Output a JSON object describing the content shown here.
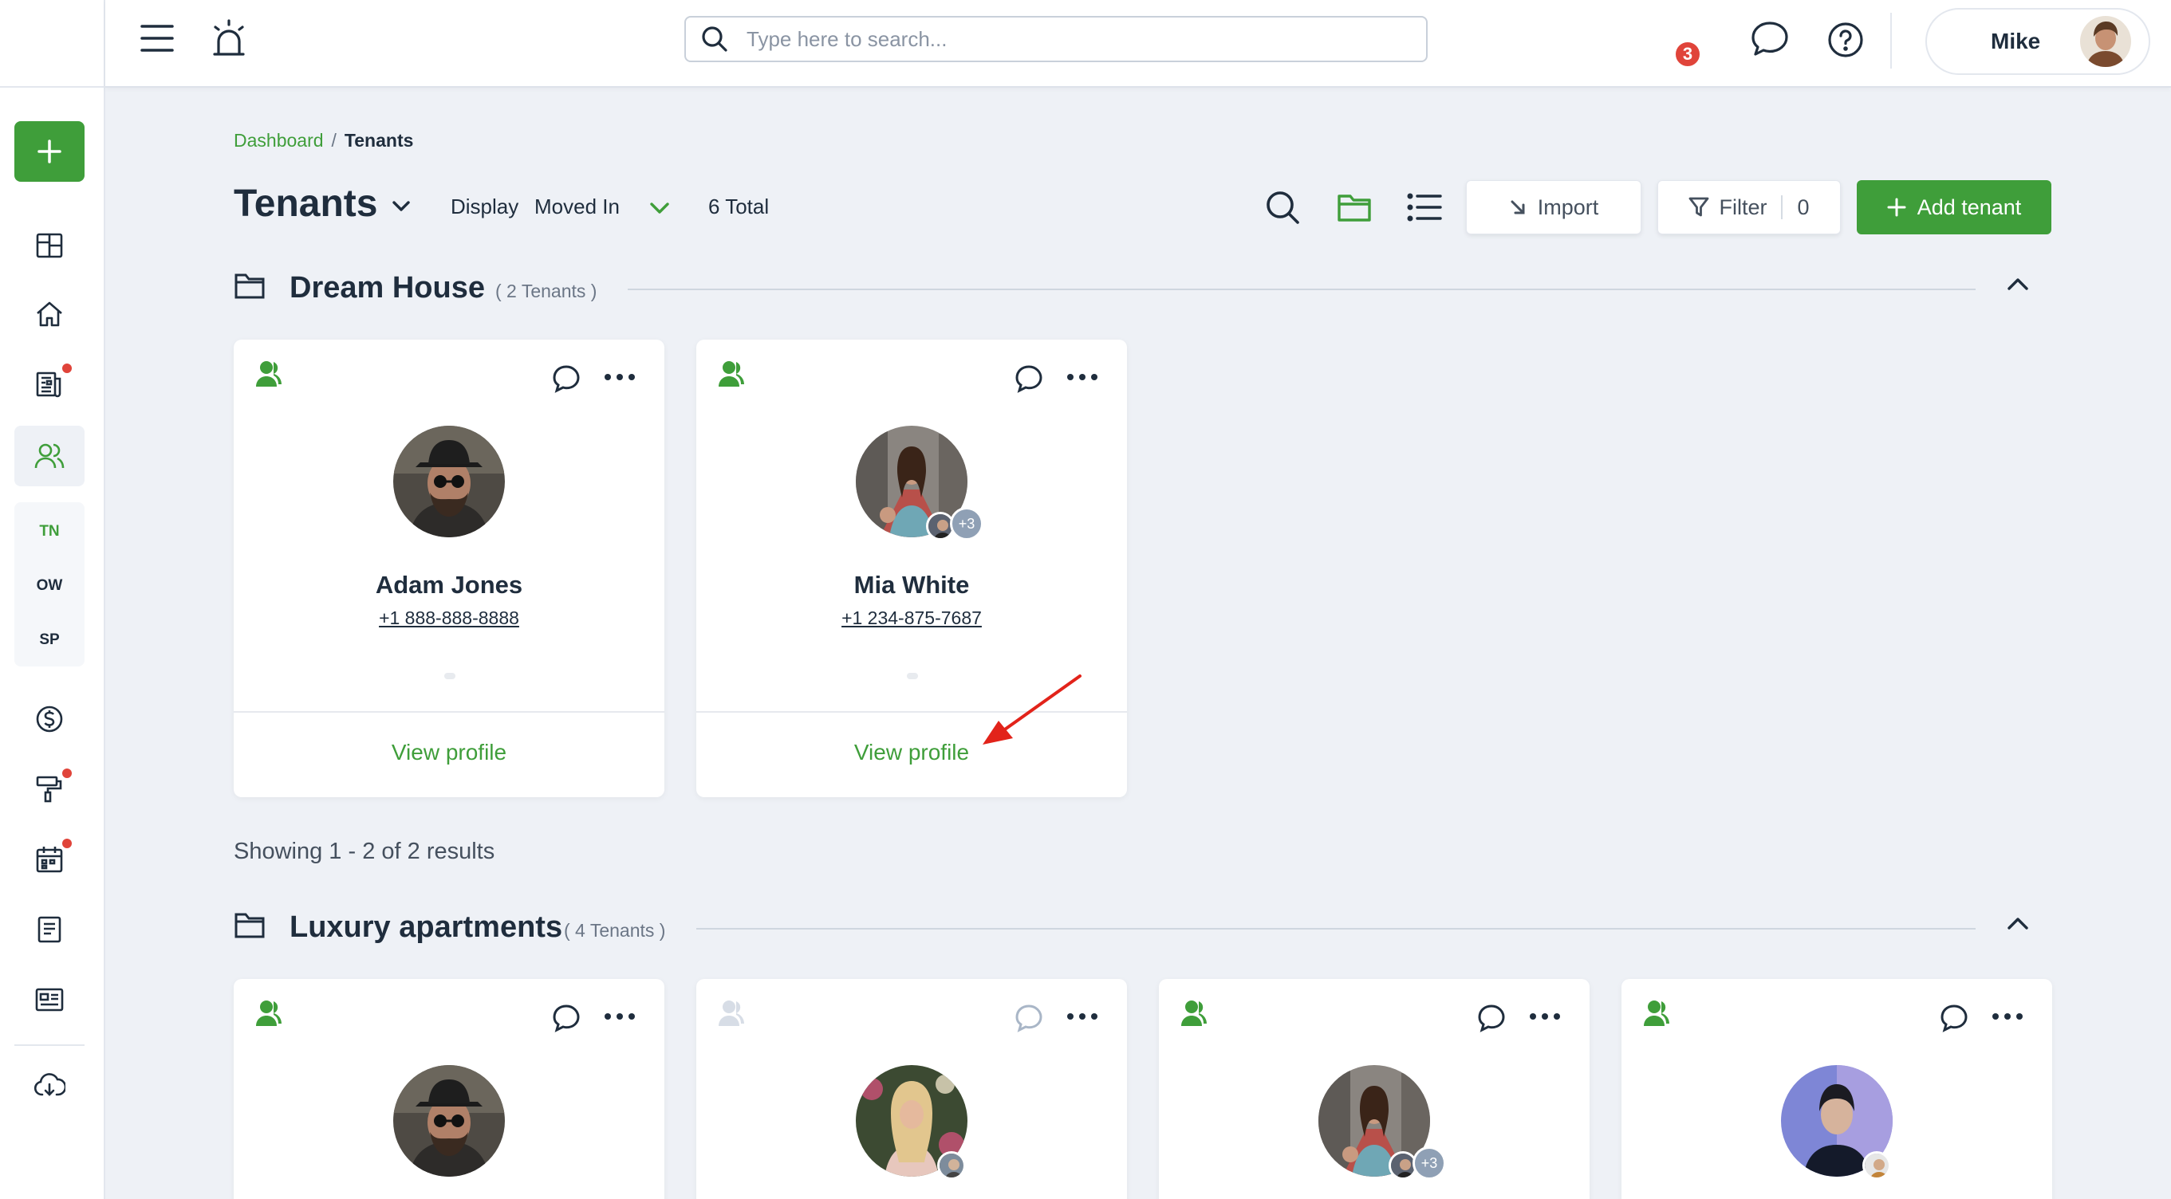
{
  "colors": {
    "accent": "#3f9e3a",
    "alert": "#e0443a",
    "text": "#1f2d3d",
    "muted": "#6b7686"
  },
  "sidebar": {
    "add_icon": "plus-icon",
    "items": [
      "dashboard-icon",
      "home-icon",
      "news-icon",
      "users-icon",
      "money-icon",
      "paint-roller-icon",
      "calendar-icon",
      "document-icon",
      "id-card-icon",
      "cloud-download-icon"
    ],
    "sub_items": [
      "TN",
      "OW",
      "SP"
    ]
  },
  "topbar": {
    "search_placeholder": "Type here to search...",
    "notification_count": "3",
    "user_name": "Mike"
  },
  "breadcrumb": {
    "link": "Dashboard",
    "separator": "/",
    "current": "Tenants"
  },
  "header": {
    "title": "Tenants",
    "display_label": "Display",
    "display_value": "Moved In",
    "total": "6 Total",
    "import_label": "Import",
    "filter_label": "Filter",
    "filter_count": "0",
    "add_label": "Add tenant"
  },
  "groups": [
    {
      "name": "Dream House",
      "count": "( 2 Tenants )",
      "tenants": [
        {
          "name": "Adam Jones",
          "phone": "+1 888-888-8888",
          "view": "View profile",
          "co_tenants": ""
        },
        {
          "name": "Mia White",
          "phone": "+1 234-875-7687",
          "view": "View profile",
          "co_tenants": "+3"
        }
      ],
      "showing": "Showing 1 - 2 of 2 results"
    },
    {
      "name": "Luxury apartments",
      "count": "( 4 Tenants )",
      "tenants": [
        {
          "co_tenants": ""
        },
        {
          "co_tenants": ""
        },
        {
          "co_tenants": "+3"
        },
        {
          "co_tenants": ""
        }
      ]
    }
  ]
}
